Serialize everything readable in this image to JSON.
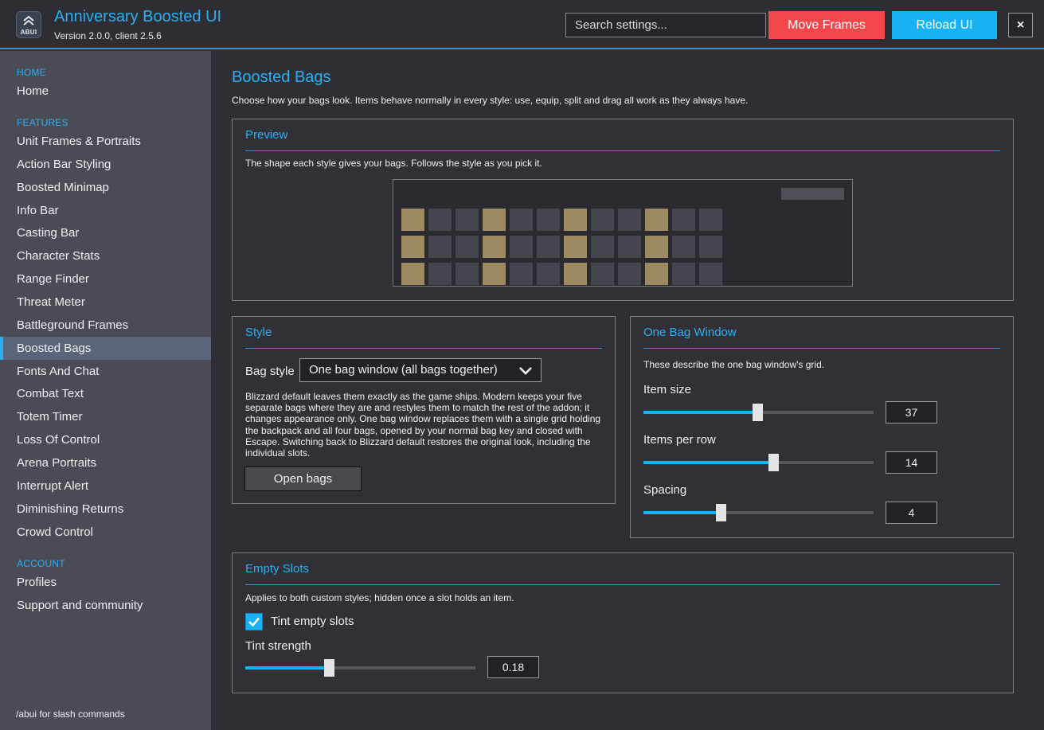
{
  "header": {
    "logo_text": "ABUI",
    "title": "Anniversary Boosted UI",
    "version": "Version 2.0.0, client 2.5.6",
    "search_placeholder": "Search settings...",
    "move_frames_label": "Move Frames",
    "reload_label": "Reload UI",
    "close_label": "×",
    "colors": {
      "accent": "#2ab0f0",
      "move": "#f3474b",
      "reload": "#16b2f4"
    }
  },
  "sidebar": {
    "sections": [
      {
        "heading": "HOME",
        "items": [
          "Home"
        ]
      },
      {
        "heading": "FEATURES",
        "items": [
          "Unit Frames & Portraits",
          "Action Bar Styling",
          "Boosted Minimap",
          "Info Bar",
          "Casting Bar",
          "Character Stats",
          "Range Finder",
          "Threat Meter",
          "Battleground Frames",
          "Boosted Bags",
          "Fonts And Chat",
          "Combat Text",
          "Totem Timer",
          "Loss Of Control",
          "Arena Portraits",
          "Interrupt Alert",
          "Diminishing Returns",
          "Crowd Control"
        ]
      },
      {
        "heading": "ACCOUNT",
        "items": [
          "Profiles",
          "Support and community"
        ]
      }
    ],
    "active_item": "Boosted Bags",
    "footer": "/abui for slash commands"
  },
  "page": {
    "title": "Boosted Bags",
    "description": "Choose how your bags look.  Items behave normally in every style: use, equip, split and drag all work as they always have."
  },
  "preview": {
    "title": "Preview",
    "description": "The shape each style gives your bags.  Follows the style as you pick it."
  },
  "style": {
    "title": "Style",
    "bag_style_label": "Bag style",
    "bag_style_value": "One bag window (all bags together)",
    "description": "Blizzard default leaves them exactly as the game ships.  Modern keeps your five separate bags where they are and restyles them to match the rest of the addon; it changes appearance only.  One bag window replaces them with a single grid holding the backpack and all four bags, opened by your normal bag key and closed with Escape.  Switching back to Blizzard default restores the original look, including the individual slots.",
    "open_bags_label": "Open bags"
  },
  "one_bag": {
    "title": "One Bag Window",
    "description": "These describe the one bag window's grid.",
    "sliders": [
      {
        "label": "Item size",
        "value": "37",
        "fill": 0.495
      },
      {
        "label": "Items per row",
        "value": "14",
        "fill": 0.565
      },
      {
        "label": "Spacing",
        "value": "4",
        "fill": 0.337
      }
    ]
  },
  "empty_slots": {
    "title": "Empty Slots",
    "description": "Applies to both custom styles; hidden once a slot holds an item.",
    "tint_label": "Tint empty slots",
    "tint_checked": true,
    "strength_label": "Tint strength",
    "strength_value": "0.18",
    "strength_fill": 0.365
  }
}
